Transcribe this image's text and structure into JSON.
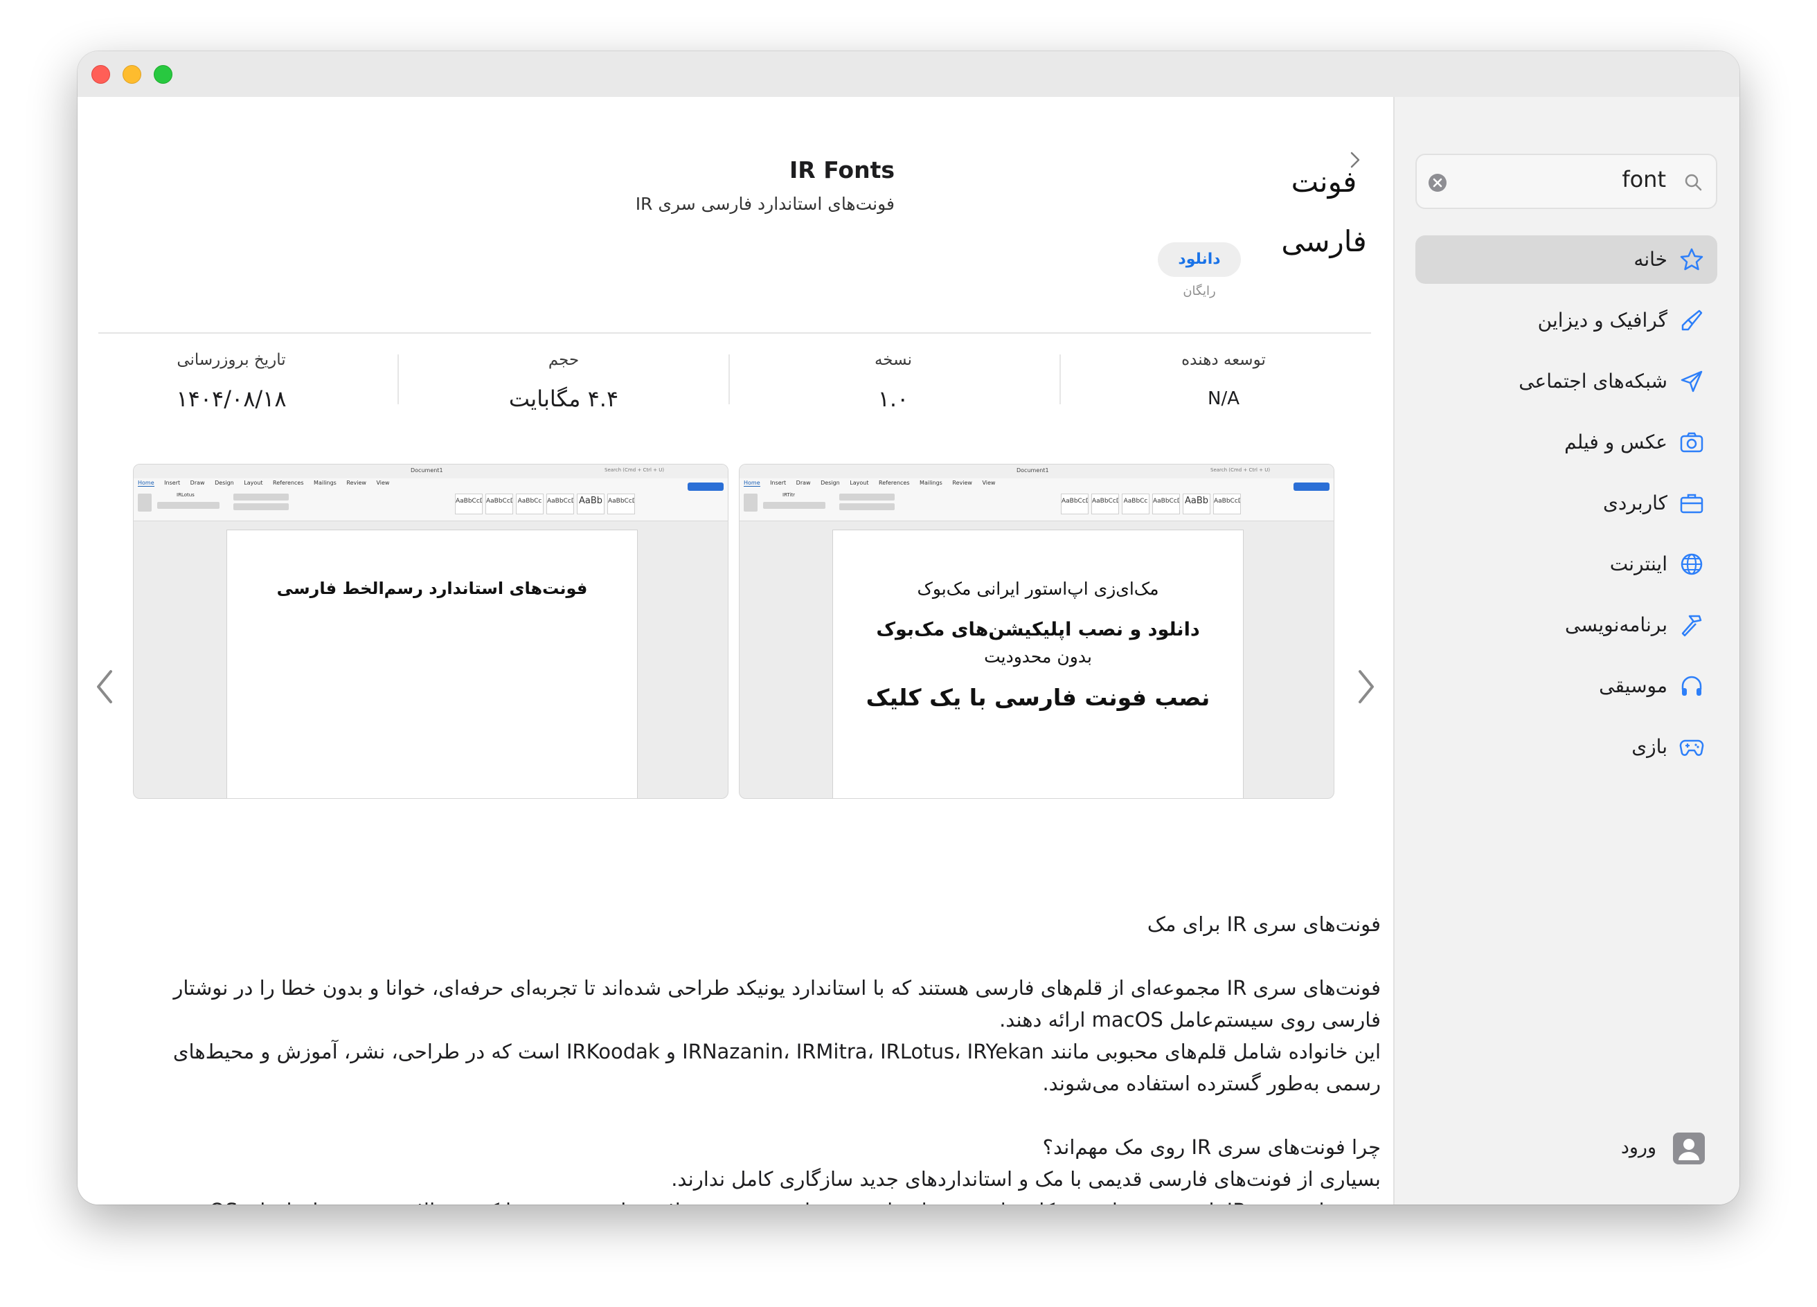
{
  "header": {
    "icon_text_line1": "فونت",
    "icon_text_line2": "فارسی",
    "app_name": "IR Fonts",
    "app_subtitle": "فونت‌های استاندارد فارسی سری IR",
    "get_button": "دانلود",
    "price": "رایگان"
  },
  "info": {
    "developer_label": "توسعه دهنده",
    "developer_value": "N/A",
    "version_label": "نسخه",
    "version_value": "۱.۰",
    "size_label": "حجم",
    "size_value": "۴.۴ مگابایت",
    "updated_label": "تاریخ بروزرسانی",
    "updated_value": "۱۴۰۴/۰۸/۱۸"
  },
  "screenshots": {
    "toolbar_tabs": [
      "Home",
      "Insert",
      "Draw",
      "Design",
      "Layout",
      "References",
      "Mailings",
      "Review",
      "View"
    ],
    "toolbar_doc_name": "Document1",
    "toolbar_search": "Search (Cmd + Ctrl + U)",
    "shot1_font": "IRLotus",
    "shot2_font": "IRTitr",
    "style_samples": [
      "AaBbCcDdE",
      "AaBbCcDdE",
      "AaBbCc",
      "AaBbCcDc",
      "AaBb",
      "AaBbCcDc"
    ],
    "shot1_line1": "فونت‌های استاندارد رسم‌الخط فارسی",
    "shot2_line1": "مک‌ای‌زی اپ‌استور ایرانی مک‌بوک",
    "shot2_line2": "دانلود و نصب اپلیکیشن‌های مک‌بوک",
    "shot2_line3": "بدون محدودیت",
    "shot2_line4": "نصب فونت فارسی با یک کلیک"
  },
  "description": {
    "title": "فونت‌های سری IR برای مک",
    "p1": "فونت‌های سری IR مجموعه‌ای از قلم‌های فارسی هستند که با استاندارد یونیکد طراحی شده‌اند تا تجربه‌ای حرفه‌ای، خوانا و بدون خطا را در نوشتار فارسی روی سیستم‌عامل macOS ارائه دهند.",
    "p2": "این خانواده شامل قلم‌های محبوبی مانند IRNazanin، IRMitra، IRLotus، IRYekan و IRKoodak است که در طراحی، نشر، آموزش و محیط‌های رسمی به‌طور گسترده استفاده می‌شوند.",
    "q1": "چرا فونت‌های سری IR روی مک مهم‌اند؟",
    "p3": "بسیاری از فونت‌های فارسی قدیمی با مک و استانداردهای جدید سازگاری کامل ندارند.",
    "p4": "فونت‌های سری IR با هدف رفع این مشکل ساخته شده‌اند تا حروف فارسی، عربی و لاتین را به‌درستی و با کیفیت بالا در همه نرم‌افزارهای macOS نمایش دهند."
  },
  "sidebar": {
    "search_value": "font",
    "items": [
      {
        "label": "خانه",
        "icon": "star-icon"
      },
      {
        "label": "گرافیک و دیزاین",
        "icon": "brush-icon"
      },
      {
        "label": "شبکه‌های اجتماعی",
        "icon": "paper-plane-icon"
      },
      {
        "label": "عکس و فیلم",
        "icon": "camera-icon"
      },
      {
        "label": "کاربردی",
        "icon": "briefcase-icon"
      },
      {
        "label": "اینترنت",
        "icon": "globe-icon"
      },
      {
        "label": "برنامه‌نویسی",
        "icon": "hammer-icon"
      },
      {
        "label": "موسیقی",
        "icon": "headphones-icon"
      },
      {
        "label": "بازی",
        "icon": "gamepad-icon"
      }
    ],
    "login_label": "ورود"
  },
  "colors": {
    "accent": "#2d7ff9",
    "sidebar_bg": "#f2f2f2",
    "active_item_bg": "#d9d9d9",
    "get_button_text": "#1a73e8"
  }
}
